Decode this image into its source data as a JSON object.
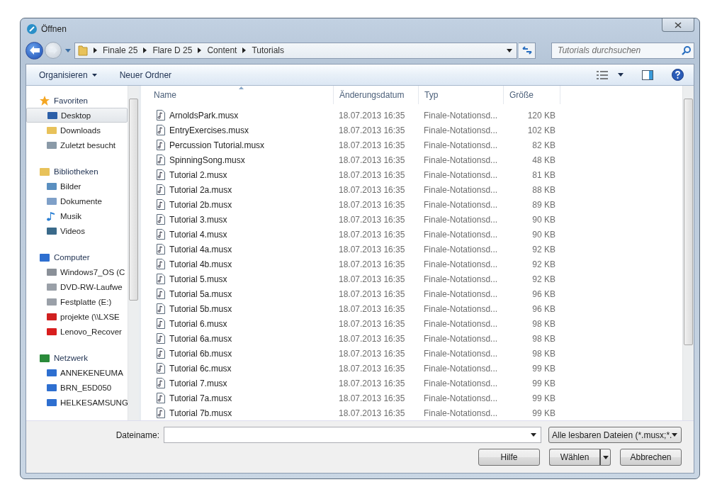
{
  "window": {
    "title": "Öffnen"
  },
  "breadcrumb": [
    "Finale 25",
    "Flare D 25",
    "Content",
    "Tutorials"
  ],
  "search": {
    "placeholder": "Tutorials durchsuchen"
  },
  "toolbar": {
    "organize": "Organisieren",
    "new_folder": "Neuer Ordner"
  },
  "sidebar": {
    "groups": [
      {
        "label": "Favoriten",
        "items": [
          {
            "label": "Desktop",
            "selected": true
          },
          {
            "label": "Downloads",
            "selected": false
          },
          {
            "label": "Zuletzt besucht",
            "selected": false
          }
        ]
      },
      {
        "label": "Bibliotheken",
        "items": [
          {
            "label": "Bilder",
            "selected": false
          },
          {
            "label": "Dokumente",
            "selected": false
          },
          {
            "label": "Musik",
            "selected": false
          },
          {
            "label": "Videos",
            "selected": false
          }
        ]
      },
      {
        "label": "Computer",
        "items": [
          {
            "label": "Windows7_OS (C",
            "selected": false
          },
          {
            "label": "DVD-RW-Laufwe",
            "selected": false
          },
          {
            "label": "Festplatte (E:)",
            "selected": false
          },
          {
            "label": "projekte (\\\\LXSE",
            "selected": false
          },
          {
            "label": "Lenovo_Recover",
            "selected": false
          }
        ]
      },
      {
        "label": "Netzwerk",
        "items": [
          {
            "label": "ANNEKENEUMA",
            "selected": false
          },
          {
            "label": "BRN_E5D050",
            "selected": false
          },
          {
            "label": "HELKESAMSUNG",
            "selected": false
          }
        ]
      }
    ]
  },
  "table": {
    "columns": [
      "Name",
      "Änderungsdatum",
      "Typ",
      "Größe"
    ],
    "rows": [
      [
        "ArnoldsPark.musx",
        "18.07.2013 16:35",
        "Finale-Notationsd...",
        "120 KB"
      ],
      [
        "EntryExercises.musx",
        "18.07.2013 16:35",
        "Finale-Notationsd...",
        "102 KB"
      ],
      [
        "Percussion Tutorial.musx",
        "18.07.2013 16:35",
        "Finale-Notationsd...",
        "82 KB"
      ],
      [
        "SpinningSong.musx",
        "18.07.2013 16:35",
        "Finale-Notationsd...",
        "48 KB"
      ],
      [
        "Tutorial 2.musx",
        "18.07.2013 16:35",
        "Finale-Notationsd...",
        "81 KB"
      ],
      [
        "Tutorial 2a.musx",
        "18.07.2013 16:35",
        "Finale-Notationsd...",
        "88 KB"
      ],
      [
        "Tutorial 2b.musx",
        "18.07.2013 16:35",
        "Finale-Notationsd...",
        "89 KB"
      ],
      [
        "Tutorial 3.musx",
        "18.07.2013 16:35",
        "Finale-Notationsd...",
        "90 KB"
      ],
      [
        "Tutorial 4.musx",
        "18.07.2013 16:35",
        "Finale-Notationsd...",
        "90 KB"
      ],
      [
        "Tutorial 4a.musx",
        "18.07.2013 16:35",
        "Finale-Notationsd...",
        "92 KB"
      ],
      [
        "Tutorial 4b.musx",
        "18.07.2013 16:35",
        "Finale-Notationsd...",
        "92 KB"
      ],
      [
        "Tutorial 5.musx",
        "18.07.2013 16:35",
        "Finale-Notationsd...",
        "92 KB"
      ],
      [
        "Tutorial 5a.musx",
        "18.07.2013 16:35",
        "Finale-Notationsd...",
        "96 KB"
      ],
      [
        "Tutorial 5b.musx",
        "18.07.2013 16:35",
        "Finale-Notationsd...",
        "96 KB"
      ],
      [
        "Tutorial 6.musx",
        "18.07.2013 16:35",
        "Finale-Notationsd...",
        "98 KB"
      ],
      [
        "Tutorial 6a.musx",
        "18.07.2013 16:35",
        "Finale-Notationsd...",
        "98 KB"
      ],
      [
        "Tutorial 6b.musx",
        "18.07.2013 16:35",
        "Finale-Notationsd...",
        "98 KB"
      ],
      [
        "Tutorial 6c.musx",
        "18.07.2013 16:35",
        "Finale-Notationsd...",
        "99 KB"
      ],
      [
        "Tutorial 7.musx",
        "18.07.2013 16:35",
        "Finale-Notationsd...",
        "99 KB"
      ],
      [
        "Tutorial 7a.musx",
        "18.07.2013 16:35",
        "Finale-Notationsd...",
        "99 KB"
      ],
      [
        "Tutorial 7b.musx",
        "18.07.2013 16:35",
        "Finale-Notationsd...",
        "99 KB"
      ]
    ]
  },
  "filename": {
    "label": "Dateiname:"
  },
  "filetype": {
    "value": "Alle lesbaren Dateien (*.musx;*."
  },
  "buttons": {
    "help": "Hilfe",
    "choose": "Wählen",
    "cancel": "Abbrechen"
  }
}
